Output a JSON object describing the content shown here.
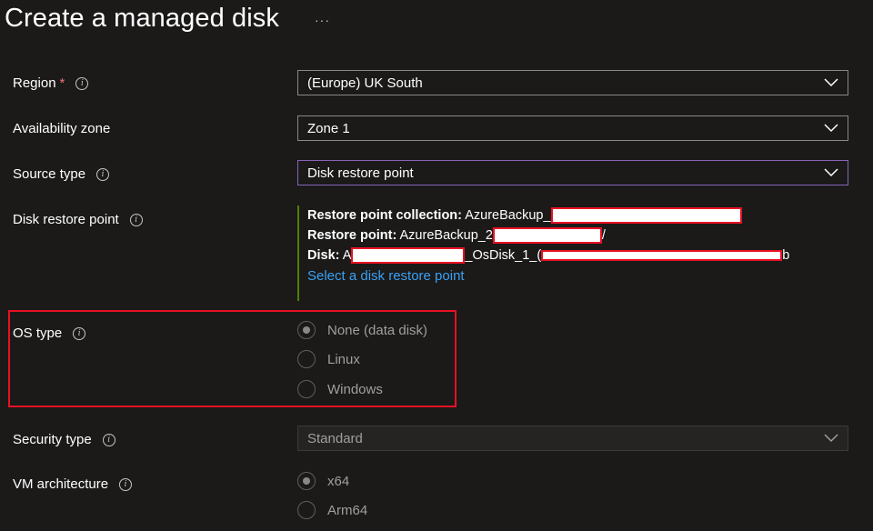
{
  "page": {
    "title": "Create a managed disk",
    "more": "···"
  },
  "region": {
    "label": "Region",
    "required": "*",
    "value": "(Europe) UK South"
  },
  "availability_zone": {
    "label": "Availability zone",
    "value": "Zone 1"
  },
  "source_type": {
    "label": "Source type",
    "value": "Disk restore point"
  },
  "disk_restore_point": {
    "label": "Disk restore point",
    "collection_label": "Restore point collection:",
    "collection_value": "AzureBackup_",
    "point_label": "Restore point:",
    "point_value": "AzureBackup_2",
    "point_tail": "/",
    "disk_label": "Disk:",
    "disk_prefix": "A",
    "disk_middle": "_OsDisk_1_(",
    "disk_tail": "b",
    "select_link": "Select a disk restore point"
  },
  "os_type": {
    "label": "OS type",
    "options": [
      "None (data disk)",
      "Linux",
      "Windows"
    ],
    "selected": "None (data disk)"
  },
  "security_type": {
    "label": "Security type",
    "value": "Standard"
  },
  "vm_architecture": {
    "label": "VM architecture",
    "options": [
      "x64",
      "Arm64"
    ],
    "selected": "x64"
  },
  "colors": {
    "accent": "#8764b8",
    "link": "#3aa0f3",
    "highlight": "#e81123",
    "valid": "#498205"
  }
}
